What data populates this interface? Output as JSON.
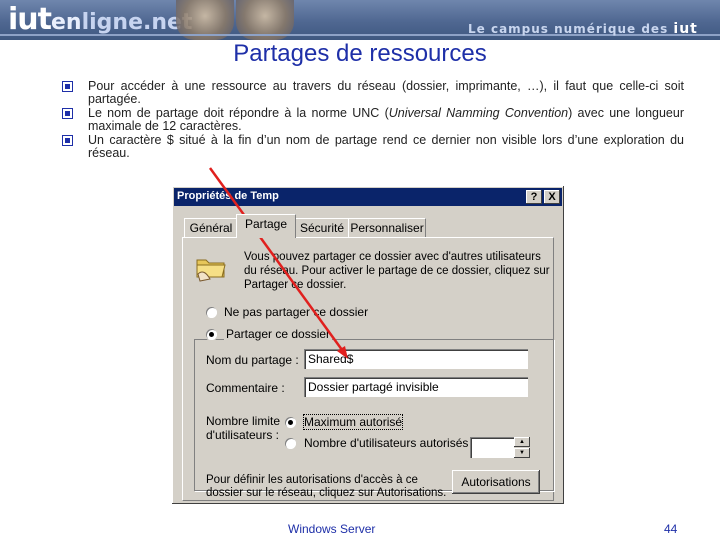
{
  "banner": {
    "logo_main": "iut",
    "logo_mid": "en",
    "logo_tail": "ligne.net",
    "tagline": "Le campus numérique des",
    "tagline_brand": "iut"
  },
  "slide": {
    "title": "Partages de ressources",
    "bullets": [
      "Pour accéder à une ressource au travers du réseau (dossier, imprimante, …), il faut que celle-ci soit partagée.",
      "Le nom de partage doit répondre à la norme UNC (",
      "Universal Namming Convention",
      ") avec une longueur maximale de 12 caractères.",
      "Un caractère $ situé à la fin d’un nom de partage rend ce dernier non visible lors d’une exploration du réseau."
    ]
  },
  "dialog": {
    "title": "Propriétés de Temp",
    "help_button": "?",
    "close_button": "X",
    "tabs": [
      "Général",
      "Partage",
      "Sécurité",
      "Personnaliser"
    ],
    "info_text": "Vous pouvez partager ce dossier avec d'autres utilisateurs du réseau. Pour activer le partage de ce dossier, cliquez sur Partager ce dossier.",
    "radio_no_share": "Ne pas partager ce dossier",
    "radio_share": "Partager ce dossier",
    "share_name_label": "Nom du partage :",
    "share_name_value": "Shared$",
    "comment_label": "Commentaire :",
    "comment_value": "Dossier partagé invisible",
    "user_limit_label_1": "Nombre limite",
    "user_limit_label_2": "d'utilisateurs :",
    "radio_max": "Maximum autorisé",
    "radio_count": "Nombre d'utilisateurs autorisés :",
    "permissions_text_1": "Pour définir les autorisations d'accès à ce",
    "permissions_text_2": "dossier sur le réseau, cliquez sur Autorisations.",
    "permissions_button": "Autorisations",
    "selected_share_option": "Partager ce dossier",
    "selected_limit_option": "Maximum autorisé"
  },
  "footer": {
    "left": "Windows Server",
    "page": "44"
  },
  "colors": {
    "title_blue": "#1e2fa8",
    "arrow_red": "#e0201e",
    "dialog_title_bg": "#0a246a",
    "dialog_face": "#d4d0c8"
  }
}
